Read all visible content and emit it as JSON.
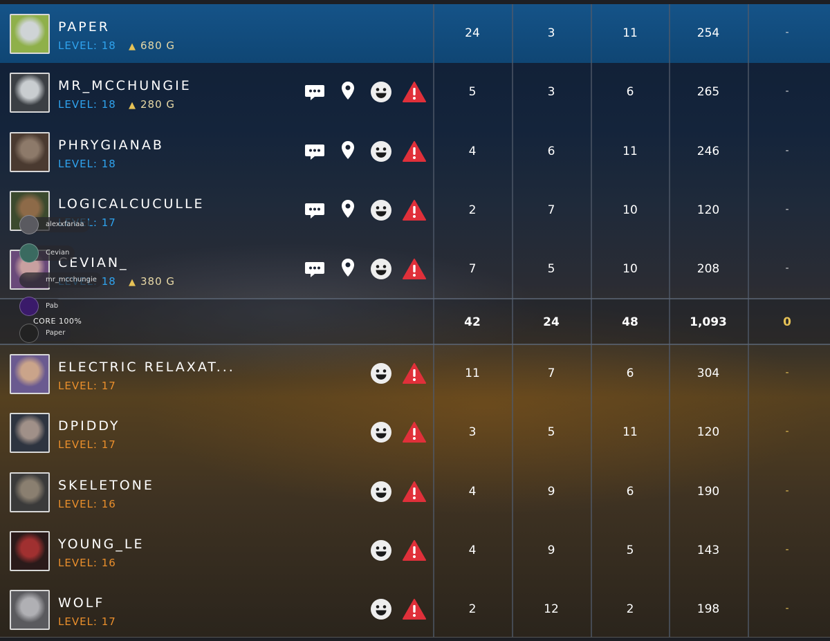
{
  "colors": {
    "team1_level": "#2fa3ee",
    "team2_level": "#ea8f2c",
    "highlight_row": "#155388",
    "gold": "#e6c256",
    "report_red": "#e0303a"
  },
  "team1": [
    {
      "name": "PAPER",
      "level": "LEVEL: 18",
      "gold": "680 G",
      "kills": "24",
      "deaths": "3",
      "assists": "11",
      "score": "254",
      "extra": "-",
      "highlight": true,
      "icons": false
    },
    {
      "name": "MR_MCCHUNGIE",
      "level": "LEVEL: 18",
      "gold": "280 G",
      "kills": "5",
      "deaths": "3",
      "assists": "6",
      "score": "265",
      "extra": "-",
      "highlight": false,
      "icons": true
    },
    {
      "name": "PHRYGIANAB",
      "level": "LEVEL: 18",
      "gold": "",
      "kills": "4",
      "deaths": "6",
      "assists": "11",
      "score": "246",
      "extra": "-",
      "highlight": false,
      "icons": true
    },
    {
      "name": "LOGICALCUCULLE",
      "level": "LEVEL: 17",
      "gold": "",
      "kills": "2",
      "deaths": "7",
      "assists": "10",
      "score": "120",
      "extra": "-",
      "highlight": false,
      "icons": true
    },
    {
      "name": "CEVIAN_",
      "level": "LEVEL: 18",
      "gold": "380 G",
      "kills": "7",
      "deaths": "5",
      "assists": "10",
      "score": "208",
      "extra": "-",
      "highlight": false,
      "icons": true
    }
  ],
  "team1_totals": {
    "kills": "42",
    "deaths": "24",
    "assists": "48",
    "score": "1,093",
    "extra": "0"
  },
  "team2": [
    {
      "name": "ELECTRIC RELAXAT...",
      "level": "LEVEL: 17",
      "kills": "11",
      "deaths": "7",
      "assists": "6",
      "score": "304",
      "extra": "-"
    },
    {
      "name": "DPIDDY",
      "level": "LEVEL: 17",
      "kills": "3",
      "deaths": "5",
      "assists": "11",
      "score": "120",
      "extra": "-"
    },
    {
      "name": "SKELETONE",
      "level": "LEVEL: 16",
      "kills": "4",
      "deaths": "9",
      "assists": "6",
      "score": "190",
      "extra": "-"
    },
    {
      "name": "YOUNG_LE",
      "level": "LEVEL: 16",
      "kills": "4",
      "deaths": "9",
      "assists": "5",
      "score": "143",
      "extra": "-"
    },
    {
      "name": "WOLF",
      "level": "LEVEL: 17",
      "kills": "2",
      "deaths": "12",
      "assists": "2",
      "score": "198",
      "extra": "-"
    }
  ],
  "overlay": {
    "voice_users": [
      "alexxfariaa",
      "Cevian",
      "mr_mcchungie",
      "Pab",
      "Paper"
    ],
    "core_label": "CORE 100%"
  },
  "icon_names": [
    "chat-icon",
    "ping-icon",
    "emote-icon",
    "report-icon",
    "gold-bag-icon"
  ]
}
